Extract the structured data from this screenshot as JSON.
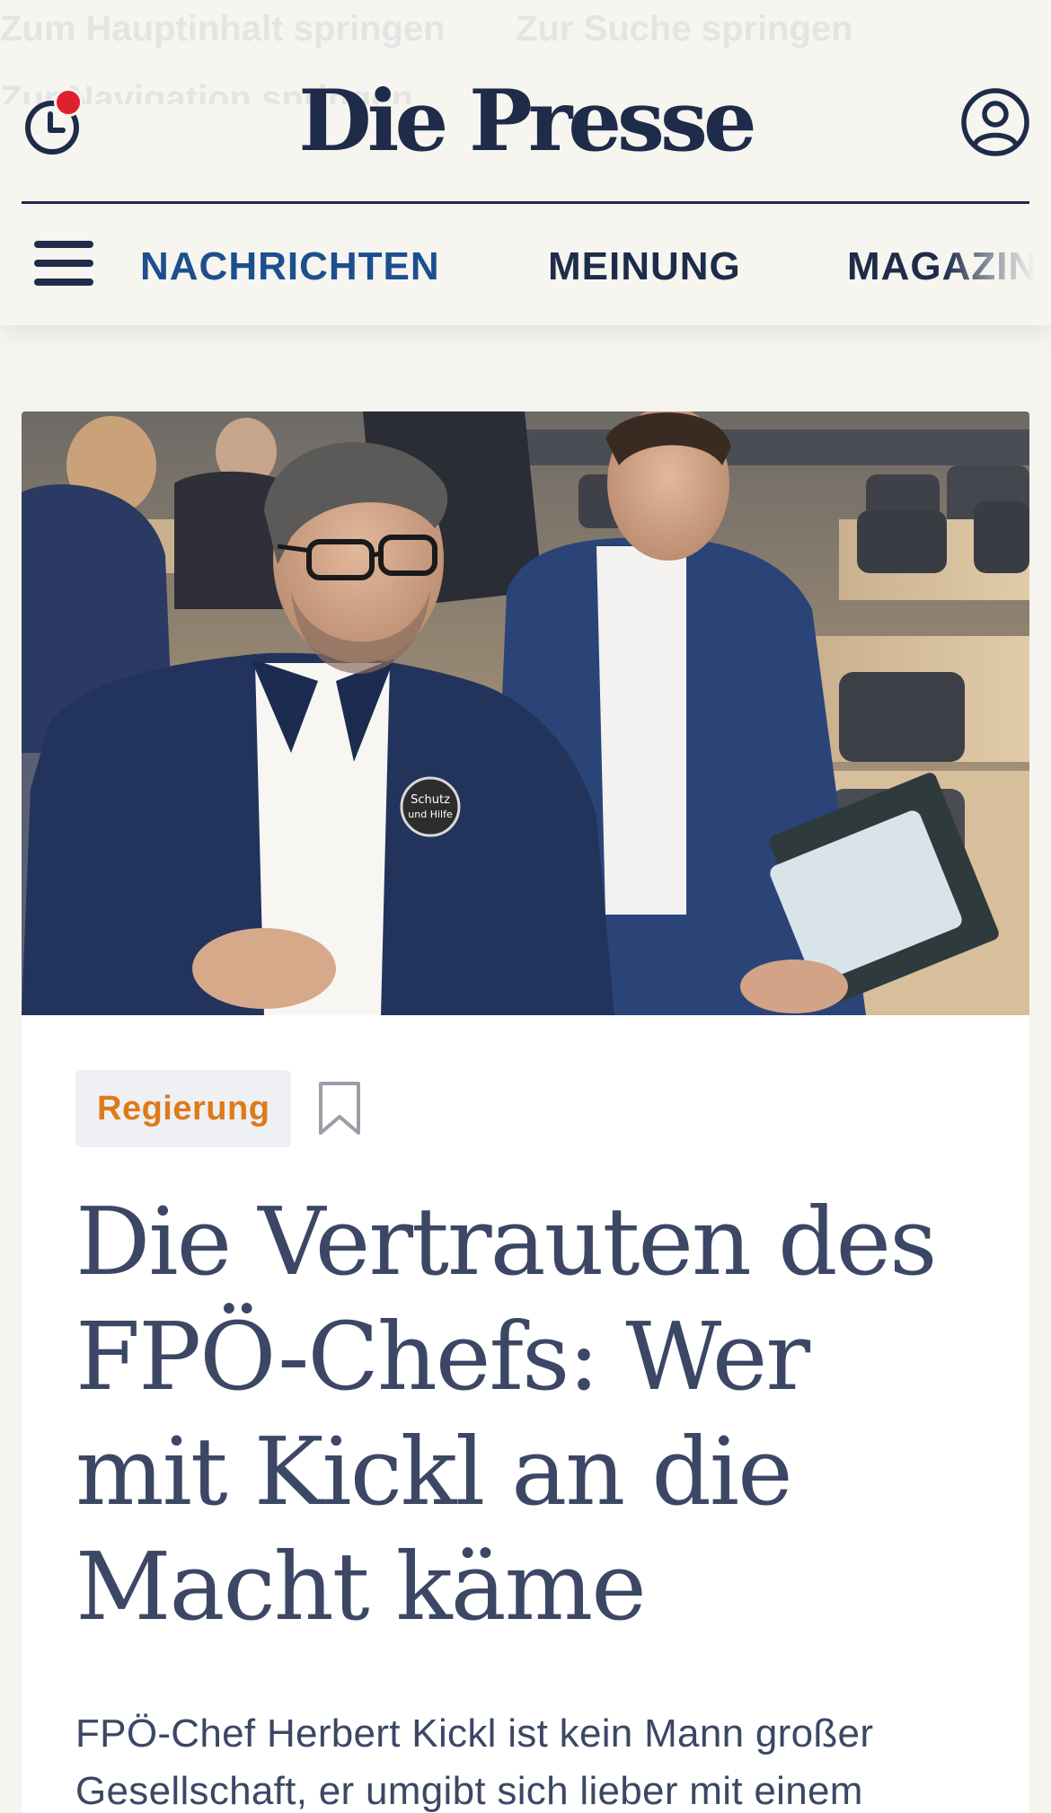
{
  "skip_links": [
    "Zum Hauptinhalt springen",
    "Zur Suche springen",
    "Zur Navigation springen"
  ],
  "header": {
    "logo": "Die Presse",
    "notification_color": "#e0202d",
    "brand_color": "#1e2c4a"
  },
  "nav": {
    "items": [
      {
        "label": "NACHRICHTEN",
        "active": true
      },
      {
        "label": "MEINUNG",
        "active": false
      },
      {
        "label": "MAGAZIN",
        "active": false
      }
    ],
    "active_color": "#1d4f8e"
  },
  "article": {
    "category": "Regierung",
    "category_color": "#dd7b19",
    "headline": "Die Vertrauten des FPÖ-Chefs: Wer mit Kickl an die Macht käme",
    "lead": "FPÖ-Chef Herbert Kickl ist kein Mann großer Gesellschaft, er umgibt sich lieber mit einem kleinen Kreis an Vertrauten.",
    "image_badge": [
      "Schutz",
      "und Hilfe"
    ]
  },
  "icons": {
    "recent": "clock-icon",
    "account": "user-icon",
    "menu": "hamburger-menu-icon",
    "bookmark": "bookmark-icon"
  }
}
